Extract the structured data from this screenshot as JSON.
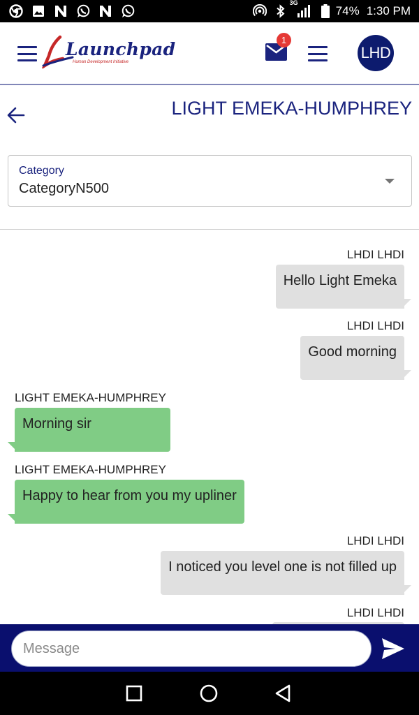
{
  "status_bar": {
    "battery": "74%",
    "time": "1:30 PM",
    "network": "3G",
    "left_icons": [
      "chrome-icon",
      "image-icon",
      "n-app-icon",
      "whatsapp-icon",
      "n-app-icon",
      "whatsapp-icon"
    ],
    "right_icons": [
      "hotspot-icon",
      "bluetooth-icon",
      "signal-icon",
      "battery-icon"
    ]
  },
  "header": {
    "logo_text": "Launchpad",
    "logo_tagline": "Human Development Initiative",
    "mail_badge": "1",
    "avatar_initials": "LHD",
    "colors": {
      "primary": "#1a237e",
      "badge": "#e53935",
      "accent": "#c62828"
    }
  },
  "conversation": {
    "title": "LIGHT EMEKA-HUMPHREY"
  },
  "category": {
    "label": "Category",
    "value": "CategoryN500"
  },
  "messages": [
    {
      "sender": "LHDI LHDI",
      "text": "Hello Light Emeka",
      "direction": "outgoing"
    },
    {
      "sender": "LHDI LHDI",
      "text": "Good morning",
      "direction": "outgoing"
    },
    {
      "sender": "LIGHT EMEKA-HUMPHREY",
      "text": "Morning sir",
      "direction": "incoming"
    },
    {
      "sender": "LIGHT EMEKA-HUMPHREY",
      "text": "Happy to hear from you my upliner",
      "direction": "incoming"
    },
    {
      "sender": "LHDI LHDI",
      "text": "I noticed you level one is not filled up",
      "direction": "outgoing"
    },
    {
      "sender": "LHDI LHDI",
      "text": "",
      "direction": "outgoing"
    }
  ],
  "composer": {
    "placeholder": "Message",
    "colors": {
      "bar": "#0a0f6e",
      "outgoing_bubble": "#e0e0e0",
      "incoming_bubble": "#80cc85"
    }
  },
  "nav_bar": {
    "buttons": [
      "recents-icon",
      "home-icon",
      "back-icon"
    ]
  }
}
